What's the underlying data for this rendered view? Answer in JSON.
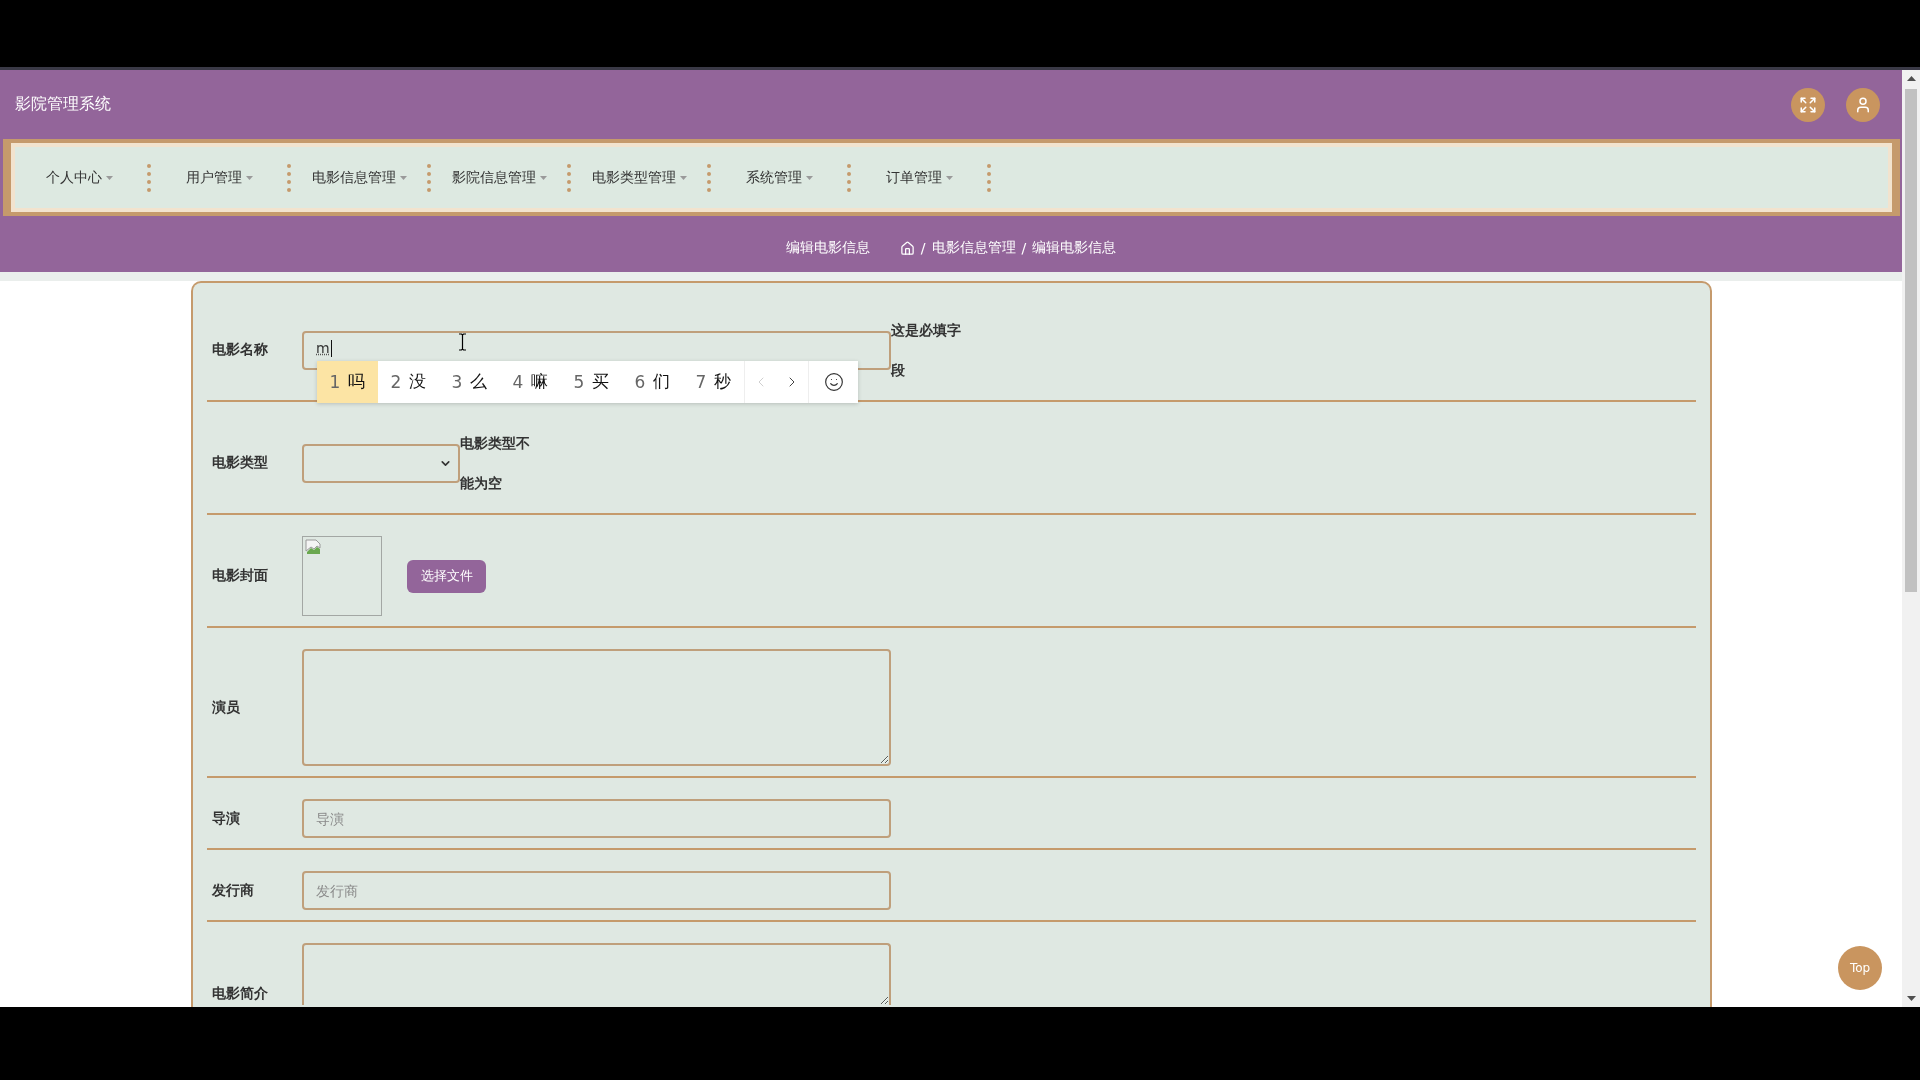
{
  "app": {
    "title": "影院管理系统"
  },
  "nav_menu": [
    "个人中心",
    "用户管理",
    "电影信息管理",
    "影院信息管理",
    "电影类型管理",
    "系统管理",
    "订单管理"
  ],
  "breadcrumb": {
    "title": "编辑电影信息",
    "separator": "/",
    "trail": [
      "电影信息管理",
      "编辑电影信息"
    ]
  },
  "form": {
    "fields": [
      {
        "kind": "text",
        "label": "电影名称",
        "value": "m",
        "hint": "这是必填字段",
        "ime": {
          "candidates": [
            {
              "number": "1",
              "text": "吗",
              "selected": true
            },
            {
              "number": "2",
              "text": "没",
              "selected": false
            },
            {
              "number": "3",
              "text": "么",
              "selected": false
            },
            {
              "number": "4",
              "text": "嘛",
              "selected": false
            },
            {
              "number": "5",
              "text": "买",
              "selected": false
            },
            {
              "number": "6",
              "text": "们",
              "selected": false
            },
            {
              "number": "7",
              "text": "秒",
              "selected": false
            }
          ],
          "previous_disabled": true,
          "next_disabled": false
        }
      },
      {
        "kind": "select",
        "label": "电影类型",
        "hint": "电影类型不能为空"
      },
      {
        "kind": "image",
        "label": "电影封面",
        "button": "选择文件"
      },
      {
        "kind": "textarea",
        "label": "演员"
      },
      {
        "kind": "text",
        "label": "导演",
        "placeholder": "导演"
      },
      {
        "kind": "text",
        "label": "发行商",
        "placeholder": "发行商"
      },
      {
        "kind": "textarea",
        "label": "电影简介"
      }
    ]
  },
  "top_button": "Top"
}
